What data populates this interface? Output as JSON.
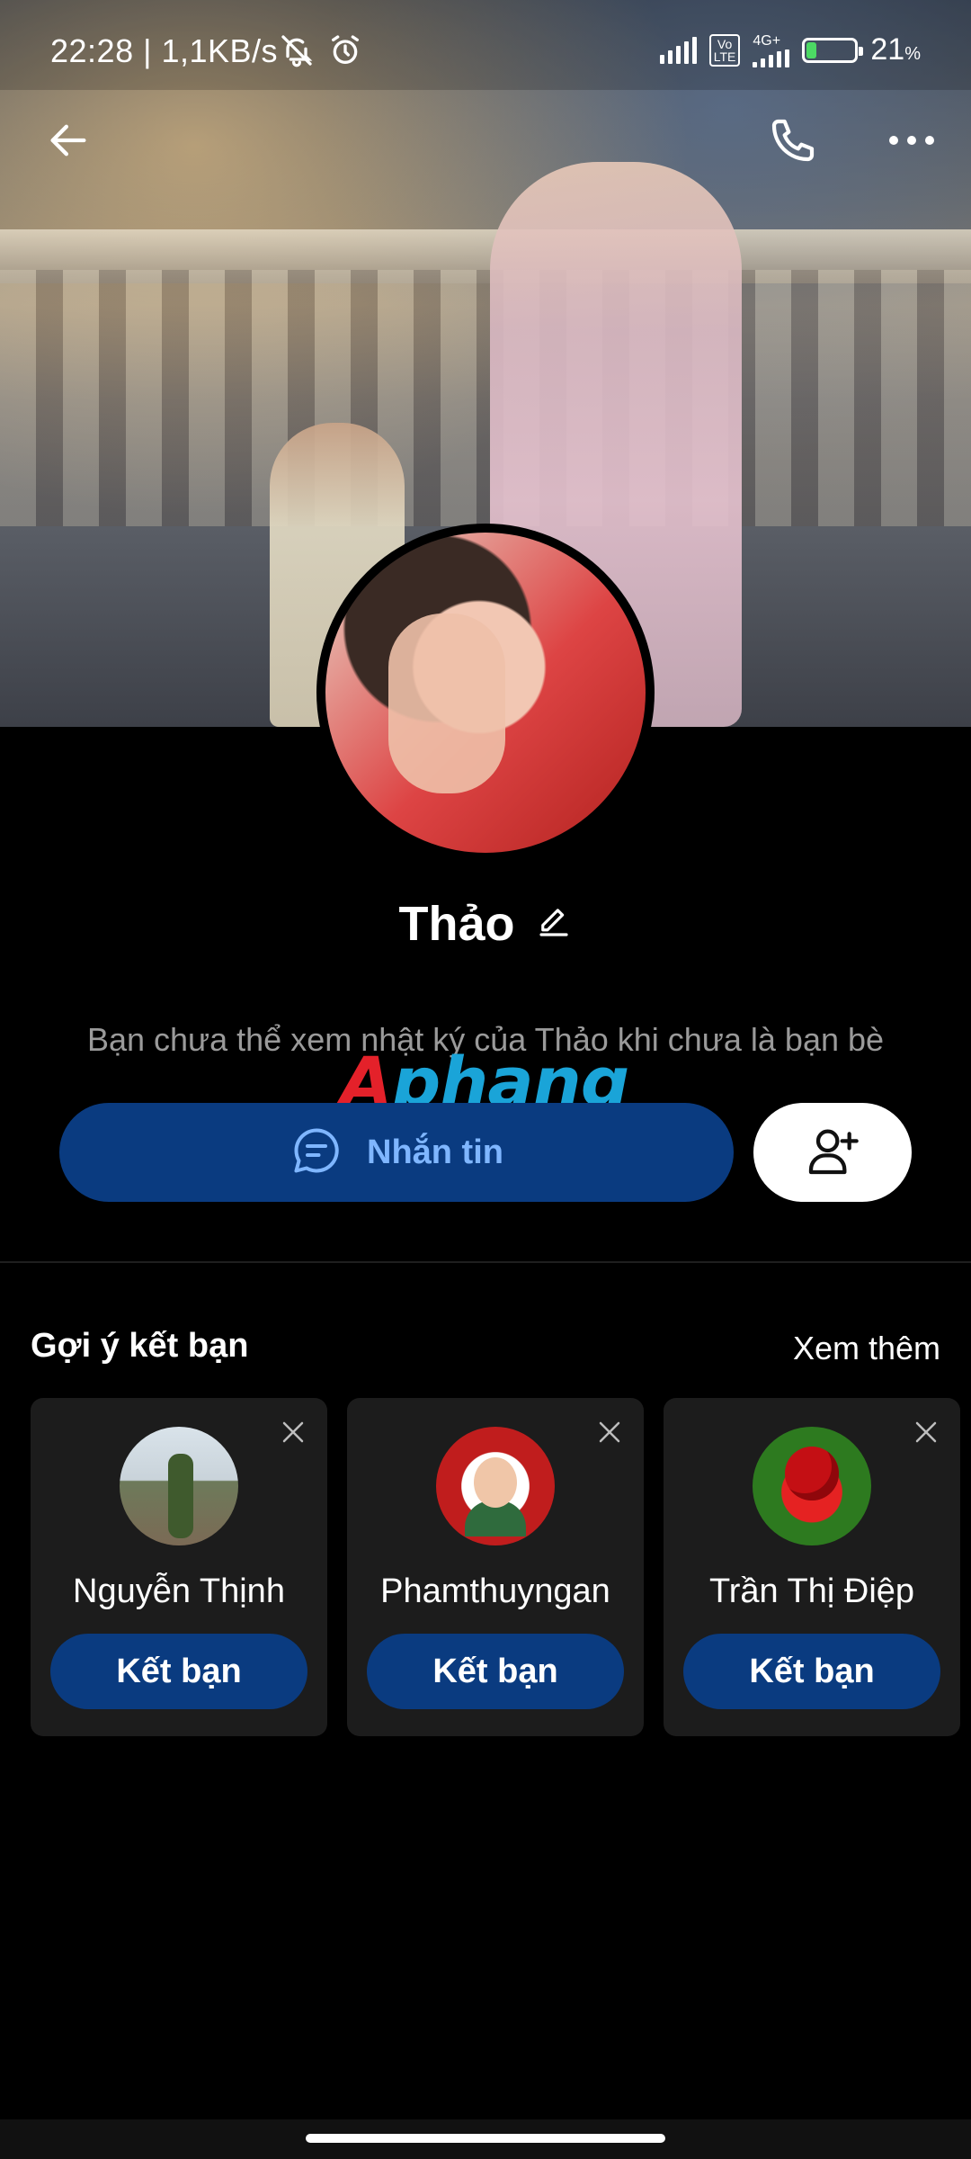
{
  "status_bar": {
    "time": "22:28",
    "network_speed": "| 1,1KB/s",
    "volte": "Vo\nLTE",
    "network_type": "4G+",
    "battery_percent": "21",
    "battery_unit": "%",
    "battery_level": 0.21,
    "battery_color": "#4cd964"
  },
  "header": {
    "back_icon": "arrow-left-icon",
    "call_icon": "phone-icon",
    "more_icon": "more-dots-icon"
  },
  "profile": {
    "name": "Thảo",
    "edit_icon": "pencil-icon",
    "diary_note": "Bạn chưa thể xem nhật ký của Thảo khi chưa là bạn bè",
    "message_button": "Nhắn tin",
    "message_icon": "chat-bubble-icon",
    "add_friend_icon": "add-user-icon"
  },
  "watermark": {
    "part1": "A",
    "part2": "phang"
  },
  "suggestions": {
    "title": "Gợi ý kết bạn",
    "see_more": "Xem thêm",
    "items": [
      {
        "name": "Nguyễn Thịnh",
        "button": "Kết bạn"
      },
      {
        "name": "Phamthuyngan",
        "button": "Kết bạn"
      },
      {
        "name": "Trần Thị Điệp",
        "button": "Kết bạn"
      }
    ]
  },
  "colors": {
    "accent": "#0a3b80",
    "accent_text": "#7fb6ff",
    "background": "#000000",
    "card": "#1c1c1c"
  }
}
